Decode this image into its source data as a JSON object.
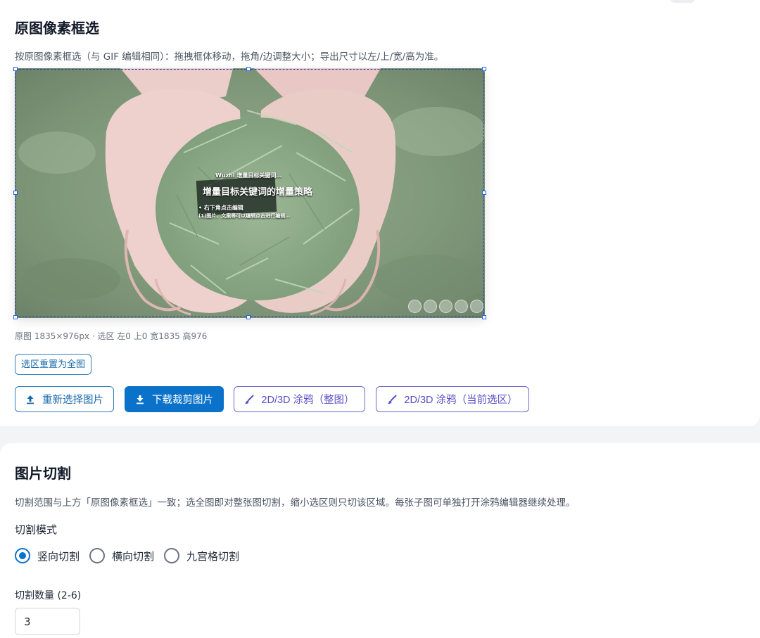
{
  "crop_section": {
    "title": "原图像素框选",
    "description": "按原图像素框选（与 GIF 编辑相同）：拖拽框体移动，拖角/边调整大小；导出尺寸以左/上/宽/高为准。",
    "image_overlay": {
      "headline": "增量目标关键词的增量策略",
      "small_line_1": "Wuzhi 增量目标关键词…",
      "small_line_2": "• 右下角点击编辑",
      "small_line_3": "(1)图片、文案等可以编辑点击进行编辑…"
    },
    "info_text": "原图 1835×976px · 选区 左0 上0 宽1835 高976",
    "reset_button": "选区重置为全图",
    "buttons": {
      "reselect": "重新选择图片",
      "download": "下载裁剪图片",
      "doodle_full": "2D/3D 涂鸦（整图）",
      "doodle_selection": "2D/3D 涂鸦（当前选区）"
    },
    "colors": {
      "primary": "#0b72c9",
      "purple": "#5b4fc4"
    }
  },
  "split_section": {
    "title": "图片切割",
    "description": "切割范围与上方「原图像素框选」一致；选全图即对整张图切割，缩小选区则只切该区域。每张子图可单独打开涂鸦编辑器继续处理。",
    "mode_label": "切割模式",
    "modes": [
      {
        "label": "竖向切割",
        "checked": true
      },
      {
        "label": "横向切割",
        "checked": false
      },
      {
        "label": "九宫格切割",
        "checked": false
      }
    ],
    "count_label": "切割数量 (2-6)",
    "count_value": "3"
  }
}
